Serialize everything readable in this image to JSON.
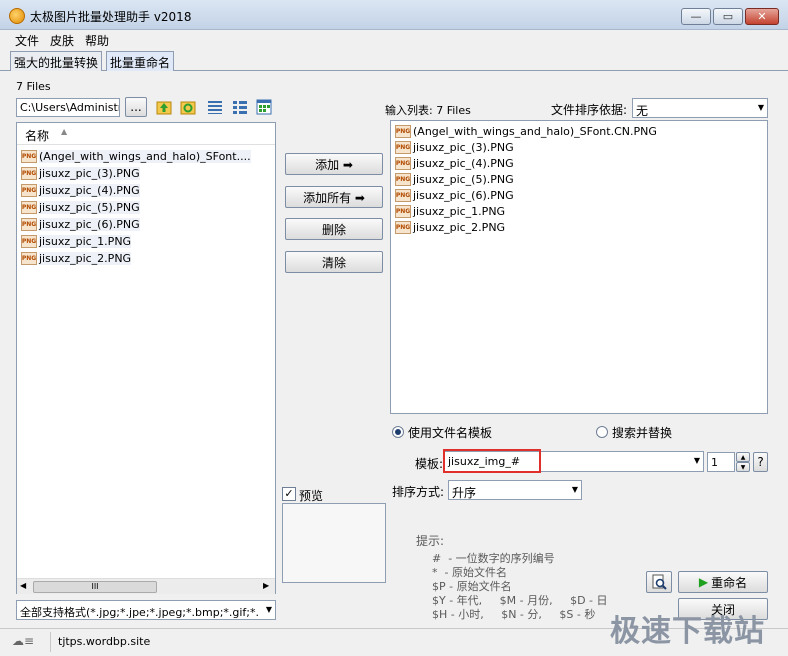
{
  "window": {
    "title": "太极图片批量处理助手  v2018"
  },
  "menu": [
    "文件",
    "皮肤",
    "帮助"
  ],
  "tabs": [
    "强大的批量转换",
    "批量重命名"
  ],
  "left": {
    "count": "7 Files",
    "path": "C:\\Users\\Administrat",
    "browse": "...",
    "column": "名称",
    "files": [
      "(Angel_with_wings_and_halo)_SFont....",
      "jisuxz_pic_(3).PNG",
      "jisuxz_pic_(4).PNG",
      "jisuxz_pic_(5).PNG",
      "jisuxz_pic_(6).PNG",
      "jisuxz_pic_1.PNG",
      "jisuxz_pic_2.PNG"
    ],
    "scroll_mark": "III",
    "filter": "全部支持格式(*.jpg;*.jpe;*.jpeg;*.bmp;*.gif;*."
  },
  "buttons": {
    "add": "添加 ➡",
    "add_all": "添加所有 ➡",
    "delete": "删除",
    "clear": "清除",
    "rename": "重命名",
    "close": "关闭"
  },
  "right": {
    "input_list": "输入列表: 7 Files",
    "sort_label": "文件排序依据:",
    "sort_value": "无",
    "files": [
      "(Angel_with_wings_and_halo)_SFont.CN.PNG",
      "jisuxz_pic_(3).PNG",
      "jisuxz_pic_(4).PNG",
      "jisuxz_pic_(5).PNG",
      "jisuxz_pic_(6).PNG",
      "jisuxz_pic_1.PNG",
      "jisuxz_pic_2.PNG"
    ]
  },
  "options": {
    "use_template": "使用文件名模板",
    "search_replace": "搜索并替换",
    "template_label": "模板:",
    "template_value": "jisuxz_img_#",
    "start_value": "1",
    "help": "?",
    "order_label": "排序方式:",
    "order_value": "升序",
    "preview": "预览"
  },
  "hints": {
    "title": "提示:",
    "lines": [
      "#  - 一位数字的序列编号",
      "*  - 原始文件名",
      "$P - 原始文件名",
      "$Y - 年代,     $M - 月份,     $D - 日",
      "$H - 小时,     $N - 分,     $S - 秒"
    ]
  },
  "status": {
    "url": "tjtps.wordbp.site"
  },
  "watermark": "极速下载站"
}
